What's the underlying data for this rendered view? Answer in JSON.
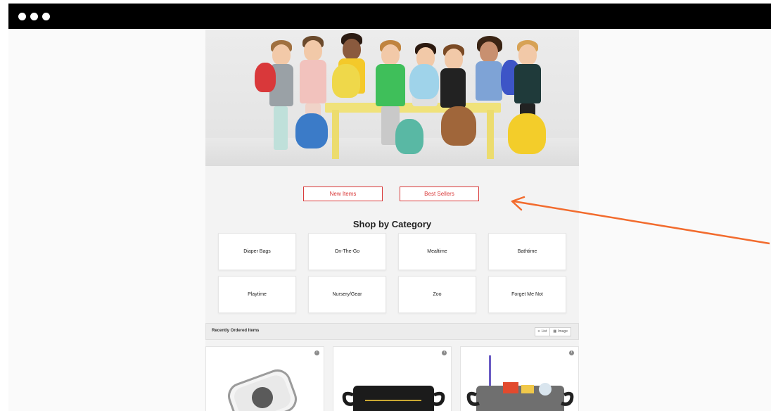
{
  "hero": {
    "alt": "Children with animal backpacks sitting on a yellow bench"
  },
  "buttons": {
    "new_items": "New Items",
    "best_sellers": "Best Sellers"
  },
  "shop": {
    "title": "Shop by Category",
    "categories": [
      "Diaper Bags",
      "On-The-Go",
      "Mealtime",
      "Bathtime",
      "Playtime",
      "Nursery/Gear",
      "Zoo",
      "Forget Me Not"
    ]
  },
  "recent": {
    "title": "Recently Ordered Items",
    "list_label": "List",
    "image_label": "Image"
  },
  "colors": {
    "accent": "#d93a3a",
    "arrow": "#f26b2d"
  }
}
